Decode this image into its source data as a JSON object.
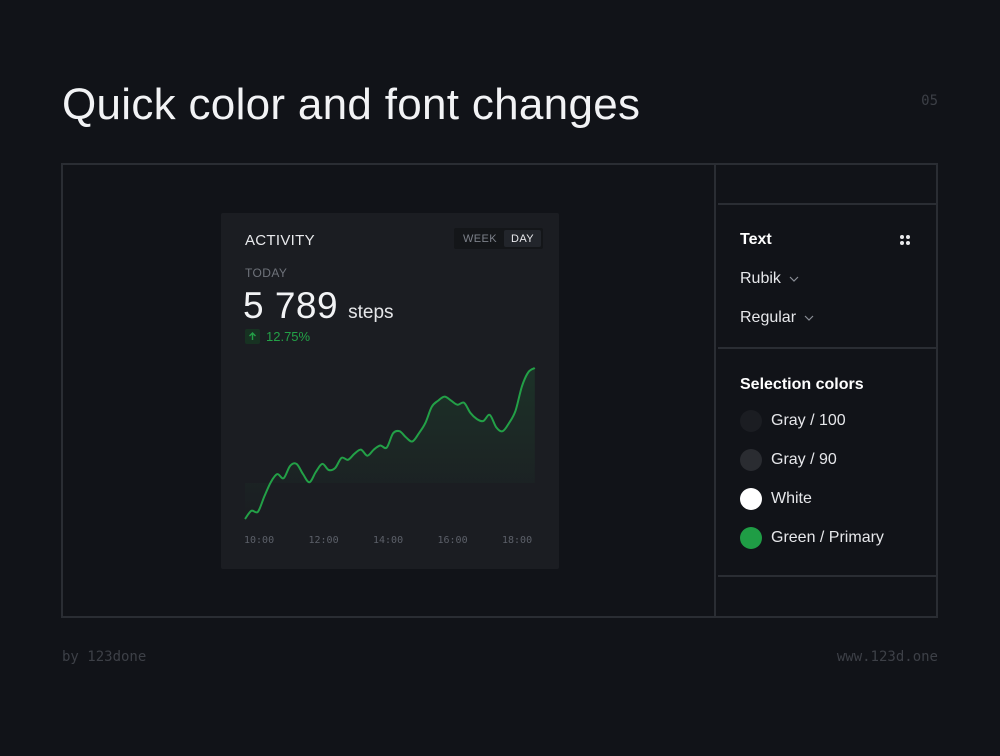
{
  "slide": {
    "title": "Quick color and font changes",
    "number": "05",
    "footer_left": "by 123done",
    "footer_right": "www.123d.one"
  },
  "panel": {
    "text_heading": "Text",
    "font_family": "Rubik",
    "font_weight": "Regular",
    "selection_heading": "Selection colors",
    "colors": [
      {
        "name": "Gray / 100",
        "hex": "#1b1d22"
      },
      {
        "name": "Gray / 90",
        "hex": "#2a2c31"
      },
      {
        "name": "White",
        "hex": "#ffffff"
      },
      {
        "name": "Green / Primary",
        "hex": "#1f9d45"
      }
    ]
  },
  "card": {
    "title": "ACTIVITY",
    "toggle": [
      "WEEK",
      "DAY"
    ],
    "active_toggle": "DAY",
    "period_label": "TODAY",
    "steps_value": "5 789",
    "steps_unit": "steps",
    "change": "12.75%",
    "accent": "#23a047"
  },
  "chart_data": {
    "type": "area",
    "x_ticks": [
      "10:00",
      "12:00",
      "14:00",
      "16:00",
      "18:00"
    ],
    "x": [
      9.5,
      9.7,
      9.9,
      10.1,
      10.3,
      10.5,
      10.7,
      10.9,
      11.1,
      11.3,
      11.5,
      11.7,
      11.9,
      12.1,
      12.3,
      12.5,
      12.7,
      12.9,
      13.1,
      13.3,
      13.5,
      13.7,
      13.9,
      14.1,
      14.3,
      14.5,
      14.7,
      14.9,
      15.1,
      15.3,
      15.5,
      15.7,
      15.9,
      16.1,
      16.3,
      16.5,
      16.7,
      16.9,
      17.1,
      17.3,
      17.5,
      17.7,
      17.9,
      18.1,
      18.3,
      18.5
    ],
    "y": [
      2,
      10,
      9,
      24,
      38,
      46,
      42,
      54,
      56,
      46,
      38,
      48,
      56,
      50,
      52,
      62,
      60,
      66,
      70,
      64,
      70,
      74,
      72,
      86,
      88,
      82,
      78,
      86,
      96,
      112,
      118,
      122,
      118,
      114,
      116,
      106,
      100,
      98,
      104,
      92,
      88,
      96,
      108,
      132,
      146,
      150
    ],
    "xlabel": "",
    "ylabel": "",
    "grid": false,
    "legend": false
  }
}
